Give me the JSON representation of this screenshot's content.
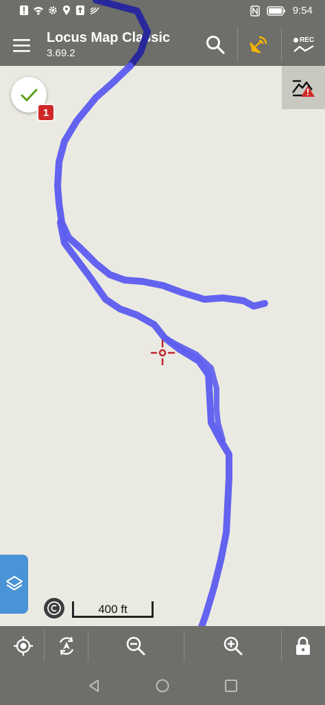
{
  "status_bar": {
    "time": "9:54",
    "left_icons": [
      "alert-icon",
      "wifi-icon",
      "gear-icon",
      "location-icon",
      "upload-icon",
      "signal-icon"
    ],
    "right_icons": [
      "nfc-icon",
      "battery-icon"
    ]
  },
  "app_bar": {
    "title": "Locus Map Classic",
    "subtitle": "3.69.2",
    "rec_label": "REC"
  },
  "map": {
    "track_color": "#5c5cf0",
    "track_dark_color": "#28289c",
    "crosshair_color": "#c0262d",
    "notification_count": "1",
    "scale_label": "400 ft"
  },
  "colors": {
    "bar_bg": "#6e6e6b",
    "map_bg": "#ebeae2",
    "gps_accent": "#f5b400",
    "layers_button": "#4a93d6"
  }
}
